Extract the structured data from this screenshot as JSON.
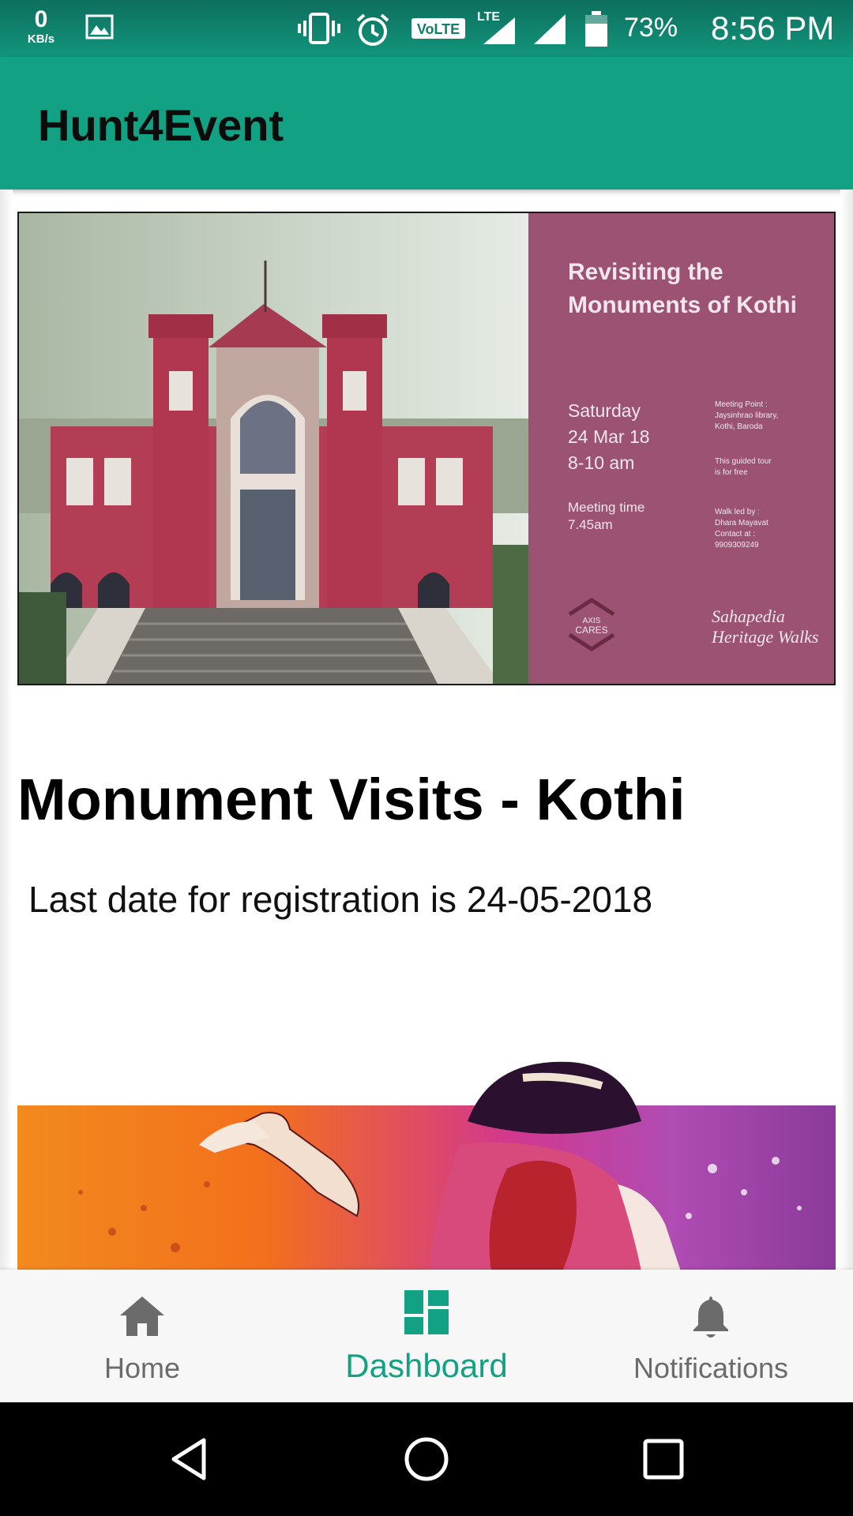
{
  "status_bar": {
    "net_speed_value": "0",
    "net_speed_unit": "KB/s",
    "network_label": "VoLTE",
    "lte_label": "LTE",
    "battery_percent": "73%",
    "time": "8:56 PM"
  },
  "app_bar": {
    "title": "Hunt4Event"
  },
  "events": [
    {
      "poster": {
        "title": "Revisiting the Monuments of Kothi",
        "date_lines": [
          "Saturday",
          "24 Mar 18",
          "8-10 am"
        ],
        "meeting_time_lines": [
          "Meeting time",
          "7.45am"
        ],
        "meeting_point_lines": [
          "Meeting Point :",
          "Jaysinhrao library,",
          "Kothi, Baroda"
        ],
        "free_lines": [
          "This guided tour",
          "is for free"
        ],
        "walk_lines": [
          "Walk led by :",
          "Dhara Mayavat",
          "Contact at :",
          "9909309249"
        ],
        "sponsor_lines": [
          "AXIS",
          "CARES"
        ],
        "series_lines": [
          "Sahapedia",
          "Heritage Walks"
        ]
      },
      "title": "Monument Visits - Kothi",
      "registration_text": "Last date for registration is 24-05-2018"
    }
  ],
  "bottom_nav": {
    "items": [
      {
        "label": "Home",
        "icon": "home-icon",
        "active": false
      },
      {
        "label": "Dashboard",
        "icon": "dashboard-icon",
        "active": true
      },
      {
        "label": "Notifications",
        "icon": "bell-icon",
        "active": false
      }
    ]
  },
  "colors": {
    "primary": "#13a183",
    "status_bar": "#0d6f5d",
    "poster_bg": "#9b5273",
    "nav_active": "#13a183",
    "nav_inactive": "#6b6b6b"
  }
}
